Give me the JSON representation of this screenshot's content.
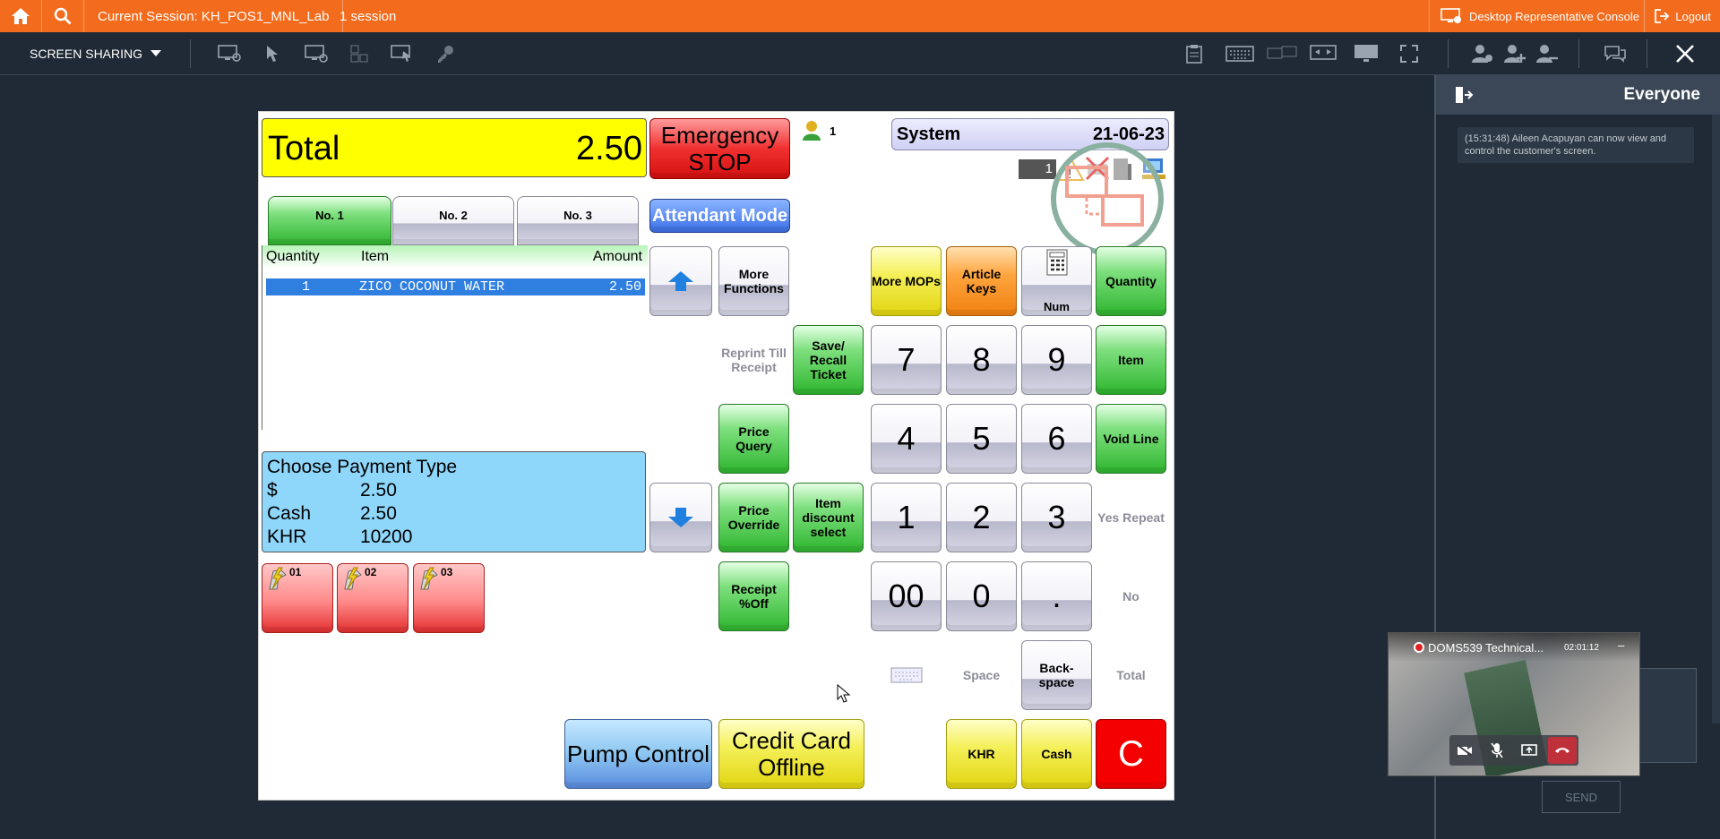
{
  "topbar": {
    "session": "Current Session: KH_POS1_MNL_Lab",
    "session_count": "1 session",
    "desktop_console": "Desktop Representative Console",
    "logout": "Logout"
  },
  "toolbar": {
    "screen_sharing": "SCREEN SHARING"
  },
  "pos": {
    "total_label": "Total",
    "total_value": "2.50",
    "emergency_stop": [
      "Emergency",
      "STOP"
    ],
    "attendant_count": "1",
    "system_label": "System",
    "system_date": "21-06-23",
    "badge_1": "1",
    "tabs": [
      "No. 1",
      "No. 2",
      "No. 3"
    ],
    "attendant_mode": "Attendant Mode",
    "columns": {
      "quantity": "Quantity",
      "item": "Item",
      "amount": "Amount"
    },
    "line": {
      "quantity": "1",
      "item": "ZICO COCONUT WATER",
      "amount": "2.50"
    },
    "payment": {
      "title": "Choose Payment Type",
      "rows": [
        {
          "label": "$",
          "value": "2.50"
        },
        {
          "label": "Cash",
          "value": "2.50"
        },
        {
          "label": "KHR",
          "value": "10200"
        }
      ]
    },
    "pumps": [
      "01",
      "02",
      "03"
    ],
    "buttons": {
      "more_functions": "More Functions",
      "reprint": "Reprint Till Receipt",
      "save_recall": "Save/ Recall Ticket",
      "price_query": "Price Query",
      "price_override": "Price Override",
      "item_discount": "Item discount select",
      "receipt_off": "Receipt %Off",
      "more_mops": "More MOPs",
      "article_keys": "Article Keys",
      "num": "Num",
      "quantity": "Quantity",
      "item": "Item",
      "void_line": "Void Line",
      "yes_repeat": "Yes Repeat",
      "no": "No",
      "space": "Space",
      "backspace": "Back- space",
      "total": "Total",
      "pump_control": "Pump Control",
      "credit_card_offline": "Credit Card Offline",
      "khr": "KHR",
      "cash": "Cash",
      "clear": "C"
    },
    "keypad": [
      "7",
      "8",
      "9",
      "4",
      "5",
      "6",
      "1",
      "2",
      "3",
      "00",
      "0",
      "."
    ]
  },
  "panel": {
    "title": "Everyone",
    "message": "(15:31:48) Aileen Acapuyan can now view and control the customer's screen.",
    "send": "SEND"
  },
  "video": {
    "title": "DOMS539 Technical...",
    "time": "02:01:12"
  }
}
